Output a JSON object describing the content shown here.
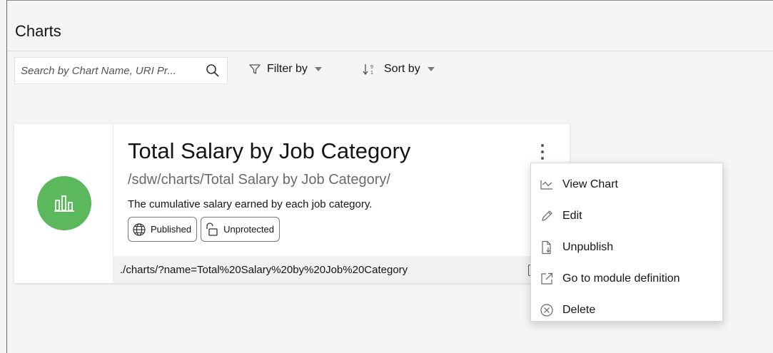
{
  "page": {
    "title": "Charts"
  },
  "toolbar": {
    "search_placeholder": "Search by Chart Name, URI Pr...",
    "filter_label": "Filter by",
    "sort_label": "Sort by"
  },
  "card": {
    "title": "Total Salary by Job Category",
    "uri": "/sdw/charts/Total Salary by Job Category/",
    "description": "The cumulative salary earned by each job category.",
    "tags": [
      "Published",
      "Unprotected"
    ],
    "footer_link": "./charts/?name=Total%20Salary%20by%20Job%20Category",
    "icon": "bar-chart-icon",
    "icon_color": "#5cb85c"
  },
  "menu": {
    "items": [
      {
        "label": "View Chart",
        "icon": "line-chart-icon"
      },
      {
        "label": "Edit",
        "icon": "pencil-icon"
      },
      {
        "label": "Unpublish",
        "icon": "unpublish-document-icon"
      },
      {
        "label": "Go to module definition",
        "icon": "external-link-icon"
      },
      {
        "label": "Delete",
        "icon": "delete-circle-icon"
      }
    ]
  }
}
